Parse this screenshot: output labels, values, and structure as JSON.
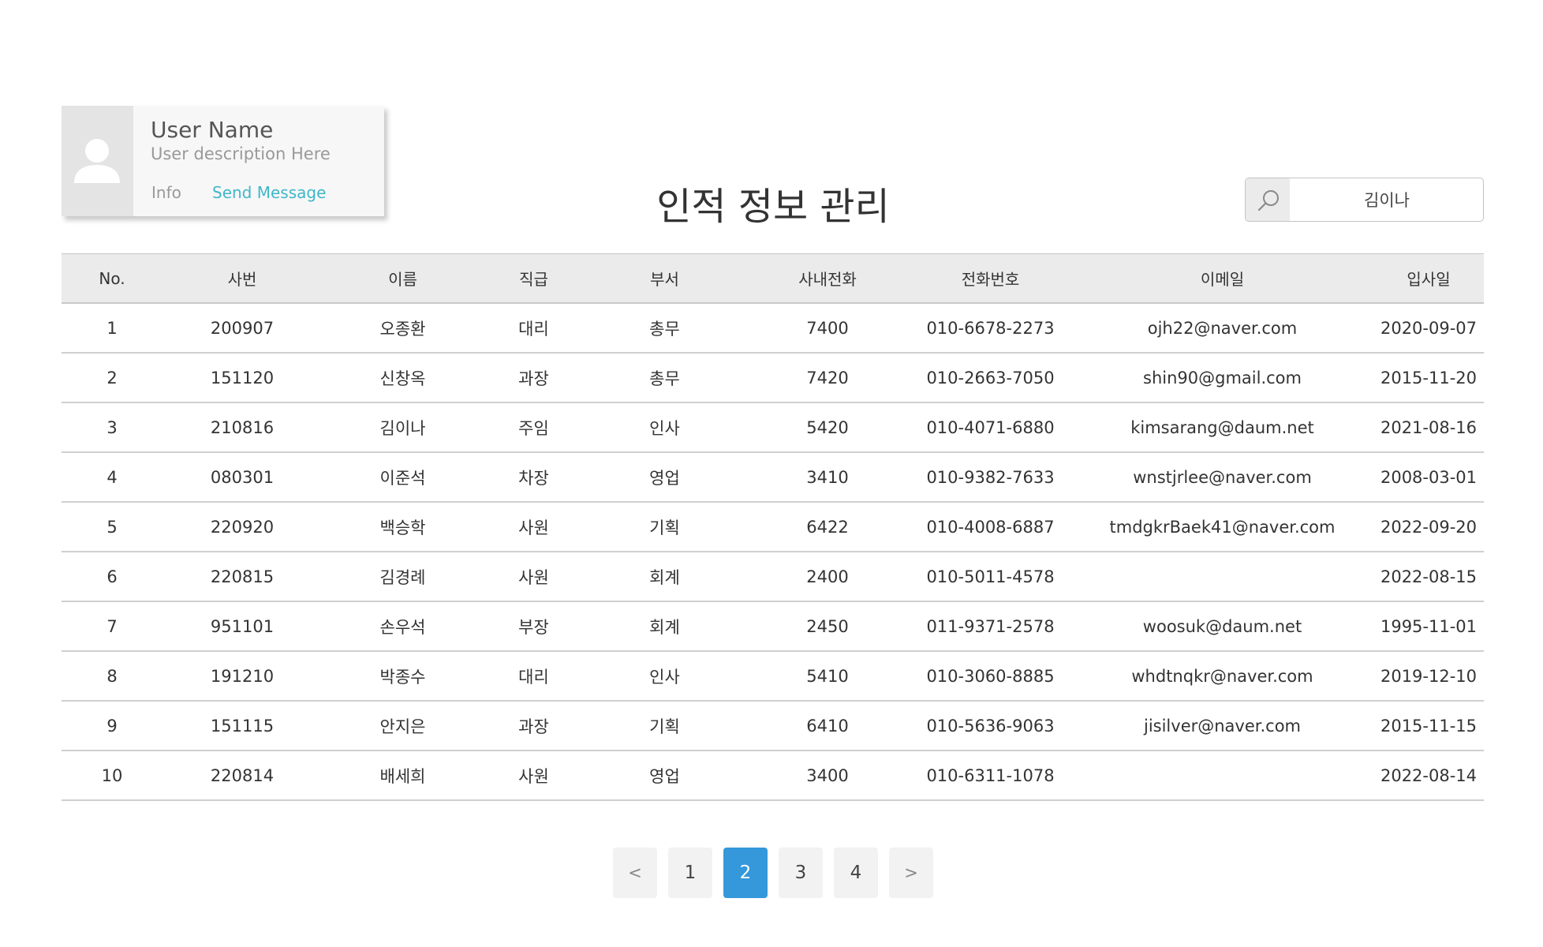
{
  "user_card": {
    "name": "User Name",
    "description": "User description Here",
    "info_link": "Info",
    "message_link": "Send Message"
  },
  "page_title": "인적 정보 관리",
  "search": {
    "value": "김이나"
  },
  "table": {
    "headers": [
      "No.",
      "사번",
      "이름",
      "직급",
      "부서",
      "사내전화",
      "전화번호",
      "이메일",
      "입사일"
    ],
    "rows": [
      [
        "1",
        "200907",
        "오종환",
        "대리",
        "총무",
        "7400",
        "010-6678-2273",
        "ojh22@naver.com",
        "2020-09-07"
      ],
      [
        "2",
        "151120",
        "신창옥",
        "과장",
        "총무",
        "7420",
        "010-2663-7050",
        "shin90@gmail.com",
        "2015-11-20"
      ],
      [
        "3",
        "210816",
        "김이나",
        "주임",
        "인사",
        "5420",
        "010-4071-6880",
        "kimsarang@daum.net",
        "2021-08-16"
      ],
      [
        "4",
        "080301",
        "이준석",
        "차장",
        "영업",
        "3410",
        "010-9382-7633",
        "wnstjrlee@naver.com",
        "2008-03-01"
      ],
      [
        "5",
        "220920",
        "백승학",
        "사원",
        "기획",
        "6422",
        "010-4008-6887",
        "tmdgkrBaek41@naver.com",
        "2022-09-20"
      ],
      [
        "6",
        "220815",
        "김경례",
        "사원",
        "회계",
        "2400",
        "010-5011-4578",
        "",
        "2022-08-15"
      ],
      [
        "7",
        "951101",
        "손우석",
        "부장",
        "회계",
        "2450",
        "011-9371-2578",
        "woosuk@daum.net",
        "1995-11-01"
      ],
      [
        "8",
        "191210",
        "박종수",
        "대리",
        "인사",
        "5410",
        "010-3060-8885",
        "whdtnqkr@naver.com",
        "2019-12-10"
      ],
      [
        "9",
        "151115",
        "안지은",
        "과장",
        "기획",
        "6410",
        "010-5636-9063",
        "jisilver@naver.com",
        "2015-11-15"
      ],
      [
        "10",
        "220814",
        "배세희",
        "사원",
        "영업",
        "3400",
        "010-6311-1078",
        "",
        "2022-08-14"
      ]
    ]
  },
  "pagination": {
    "prev": "<",
    "pages": [
      "1",
      "2",
      "3",
      "4"
    ],
    "active_page": "2",
    "next": ">"
  },
  "colors": {
    "accent": "#3498db",
    "link": "#3fb7c9",
    "header_bg": "#ebebeb"
  }
}
